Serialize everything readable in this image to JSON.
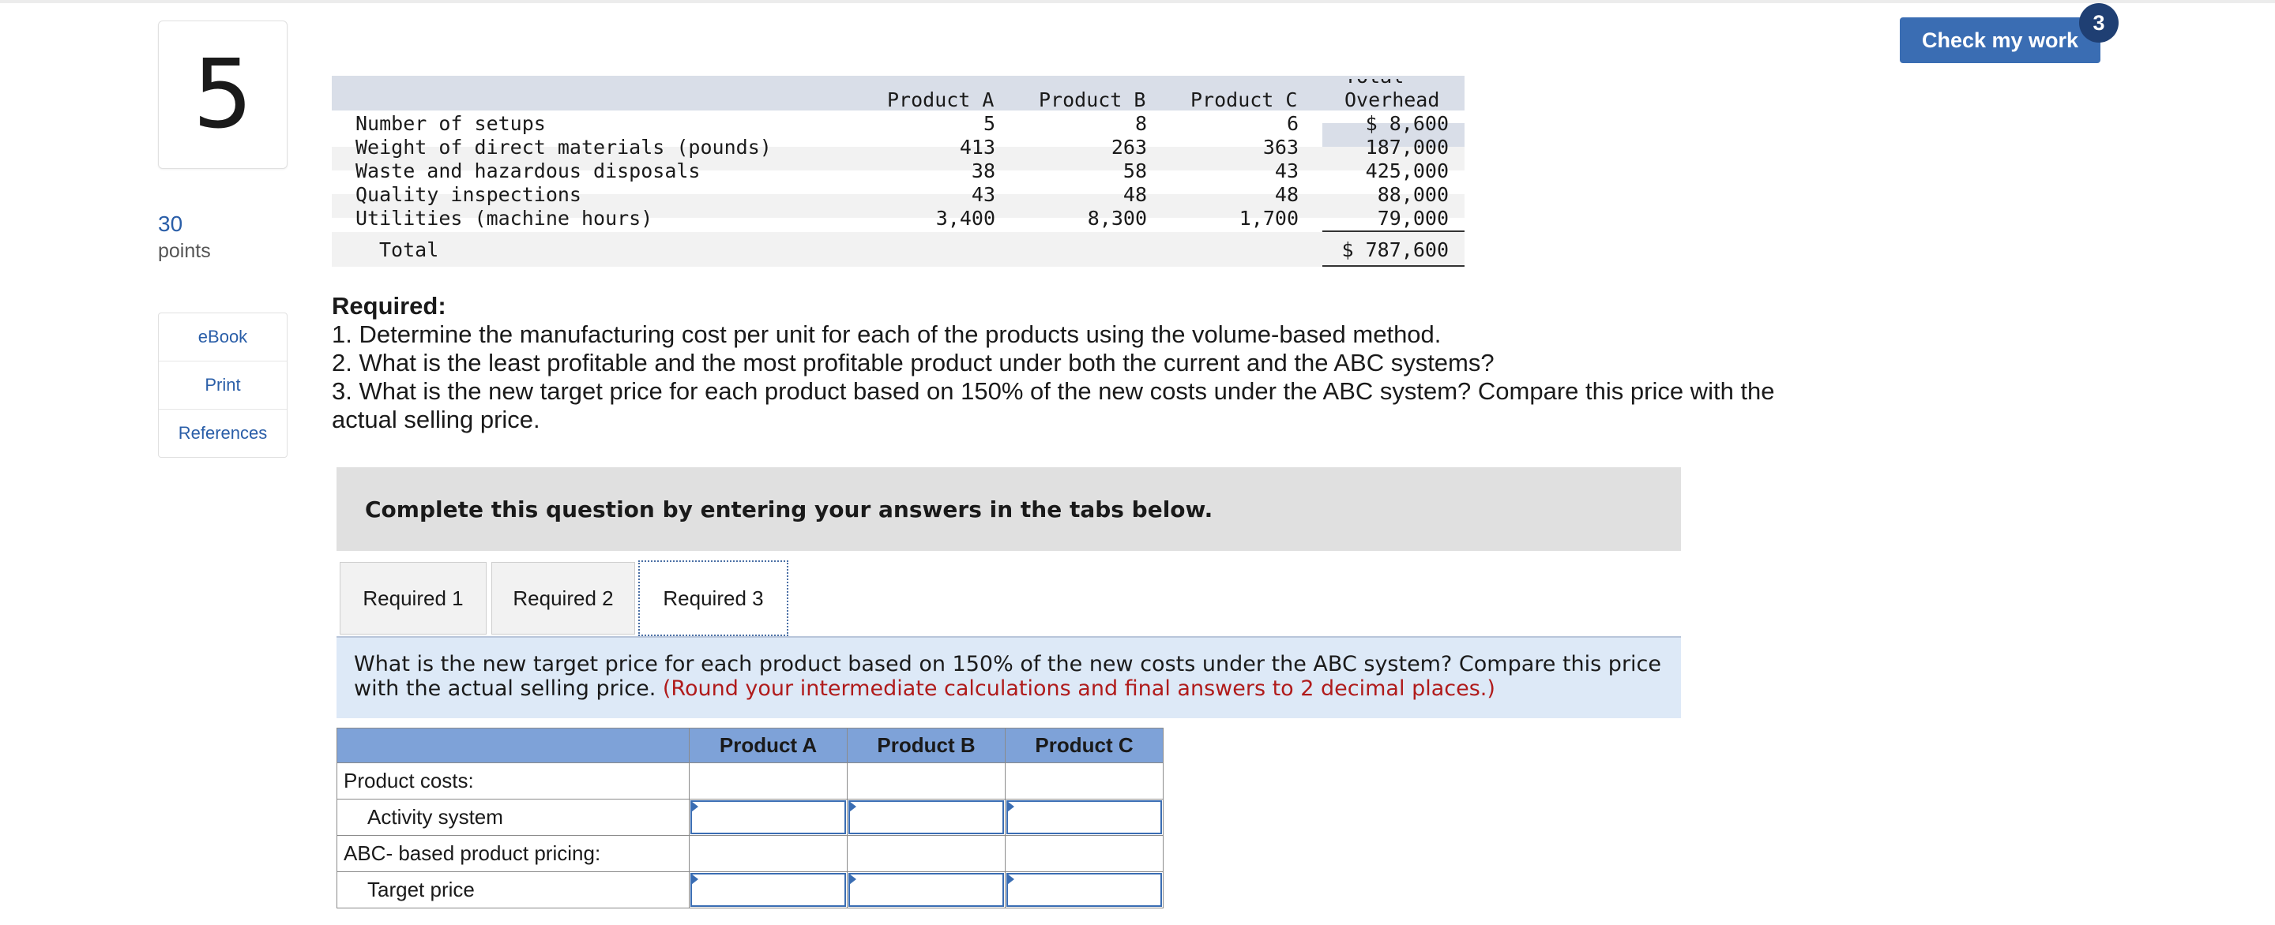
{
  "question": {
    "number": "5",
    "points_value": "30",
    "points_label": "points"
  },
  "side_links": [
    "eBook",
    "Print",
    "References"
  ],
  "check_button": {
    "label": "Check my work",
    "badge": "3"
  },
  "data_table": {
    "headers": [
      "Product A",
      "Product B",
      "Product C",
      "Total",
      "Overhead"
    ],
    "rows": [
      {
        "label": "Number of setups",
        "a": "5",
        "b": "8",
        "c": "6",
        "total": "$ 8,600"
      },
      {
        "label": "Weight of direct materials (pounds)",
        "a": "413",
        "b": "263",
        "c": "363",
        "total": "187,000"
      },
      {
        "label": "Waste and hazardous disposals",
        "a": "38",
        "b": "58",
        "c": "43",
        "total": "425,000"
      },
      {
        "label": "Quality inspections",
        "a": "43",
        "b": "48",
        "c": "48",
        "total": "88,000"
      },
      {
        "label": "Utilities (machine hours)",
        "a": "3,400",
        "b": "8,300",
        "c": "1,700",
        "total": "79,000"
      }
    ],
    "total_label": "Total",
    "total_value": "$ 787,600"
  },
  "required": {
    "title": "Required:",
    "items": [
      "1. Determine the manufacturing cost per unit for each of the products using the volume-based method.",
      "2. What is the least profitable and the most profitable product under both the current and the ABC systems?",
      "3. What is the new target price for each product based on 150% of the new costs under the ABC system? Compare this price with the actual selling price."
    ]
  },
  "instruction": "Complete this question by entering your answers in the tabs below.",
  "tabs": [
    "Required 1",
    "Required 2",
    "Required 3"
  ],
  "active_tab": "Required 3",
  "prompt": {
    "text": "What is the new target price for each product based on 150% of the new costs under the ABC system? Compare this price with the actual selling price.",
    "note": "(Round your intermediate calculations and final answers to 2 decimal places.)"
  },
  "answer_grid": {
    "columns": [
      "Product A",
      "Product B",
      "Product C"
    ],
    "rows": [
      {
        "label": "Product costs:",
        "indent": false,
        "inputs": false
      },
      {
        "label": "Activity system",
        "indent": true,
        "inputs": true
      },
      {
        "label": "ABC- based product pricing:",
        "indent": false,
        "inputs": false
      },
      {
        "label": "Target price",
        "indent": true,
        "inputs": true
      }
    ]
  }
}
